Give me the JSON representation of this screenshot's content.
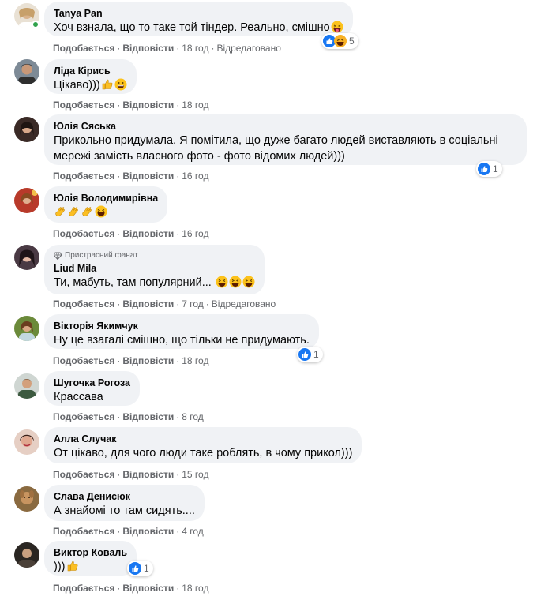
{
  "actions": {
    "like": "Подобається",
    "reply": "Відповісти",
    "edited": "Відредаговано"
  },
  "comments": [
    {
      "name": "Tanya Pan",
      "text": "Хоч взнала, що то такe той тіндер. Реально, смішно",
      "time": "18 год",
      "reactions": "5"
    },
    {
      "name": "Ліда Кірись",
      "text": "Цікаво)))",
      "time": "18 год"
    },
    {
      "name": "Юлія Сяська",
      "text": "Прикольно придумала. Я помітила, що дуже багато людей виставляють в соціальні мережі замість власного фото - фото відомих людей)))",
      "time": "16 год",
      "reactions": "1"
    },
    {
      "name": "Юлія Володимирівна",
      "text": "",
      "time": "16 год"
    },
    {
      "badge": "Пристрасний фанат",
      "name": "Liud Mila",
      "text": "Ти, мабуть, там популярний...",
      "time": "7 год"
    },
    {
      "name": "Вікторія Якимчук",
      "text": "Ну це взагалі смішно, що тільки не придумають.",
      "time": "18 год",
      "reactions": "1"
    },
    {
      "name": "Шугочка Рогоза",
      "text": "Крассава",
      "time": "8 год"
    },
    {
      "name": "Алла Случак",
      "text": "От цікаво, для чого люди таке роблять, в чому прикол)))",
      "time": "15 год"
    },
    {
      "name": "Слава Денисюк",
      "text": "А знайомі то там сидять....",
      "time": "4 год"
    },
    {
      "name": "Виктор Коваль",
      "text": ")))",
      "time": "18 год",
      "reactions": "1"
    }
  ],
  "colors": {
    "bubble": "#f0f2f5",
    "meta": "#65676b",
    "like_blue": "#1877f2",
    "online": "#31a24c"
  }
}
